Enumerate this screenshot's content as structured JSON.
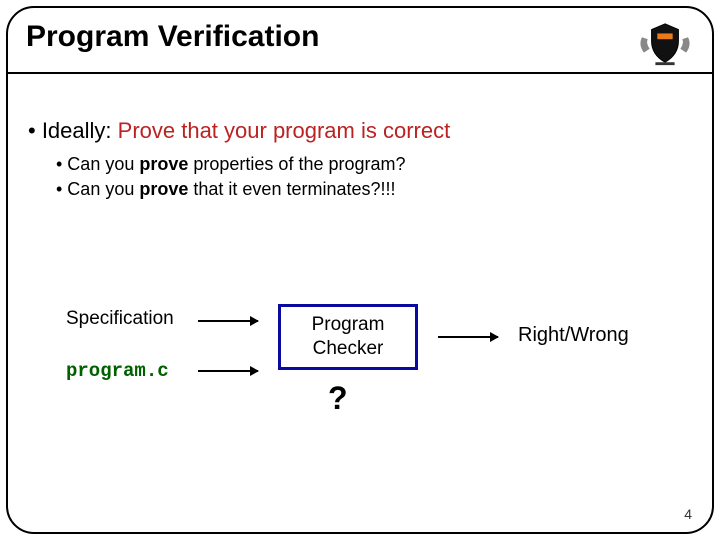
{
  "title": "Program Verification",
  "bullets": {
    "main_prefix": "• Ideally:  ",
    "main_red": "Prove that your program is correct",
    "sub1_a": "• Can you ",
    "sub1_b": "prove",
    "sub1_c": " properties of the program?",
    "sub2_a": "• Can you ",
    "sub2_b": "prove",
    "sub2_c": " that it even terminates?!!!"
  },
  "diagram": {
    "spec": "Specification",
    "program": "program.c",
    "checker": "Program Checker",
    "question": "?",
    "output": "Right/Wrong"
  },
  "page_number": "4"
}
